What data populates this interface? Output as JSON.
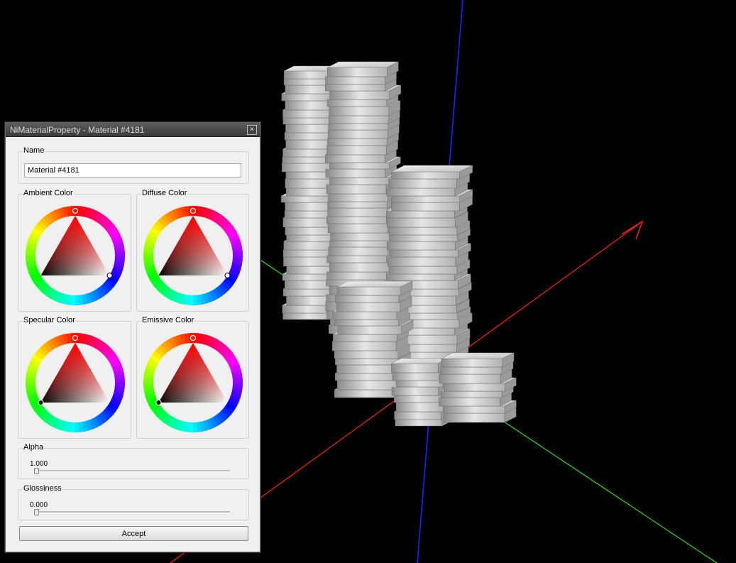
{
  "dialog": {
    "title": "NiMaterialProperty - Material #4181",
    "close_glyph": "×",
    "name": {
      "label": "Name",
      "value": "Material #4181"
    },
    "colors": [
      {
        "label": "Ambient Color"
      },
      {
        "label": "Diffuse Color"
      },
      {
        "label": "Specular Color"
      },
      {
        "label": "Emissive Color"
      }
    ],
    "alpha": {
      "label": "Alpha",
      "value": "1.000",
      "fraction": 0
    },
    "glossiness": {
      "label": "Glossiness",
      "value": "0.000",
      "fraction": 0
    },
    "accept_label": "Accept"
  },
  "scene": {
    "x_axis_color": "#ff2020",
    "y_axis_color": "#20e020",
    "z_axis_color": "#2020ff",
    "model_description": "stacked books",
    "background": "#000000"
  }
}
